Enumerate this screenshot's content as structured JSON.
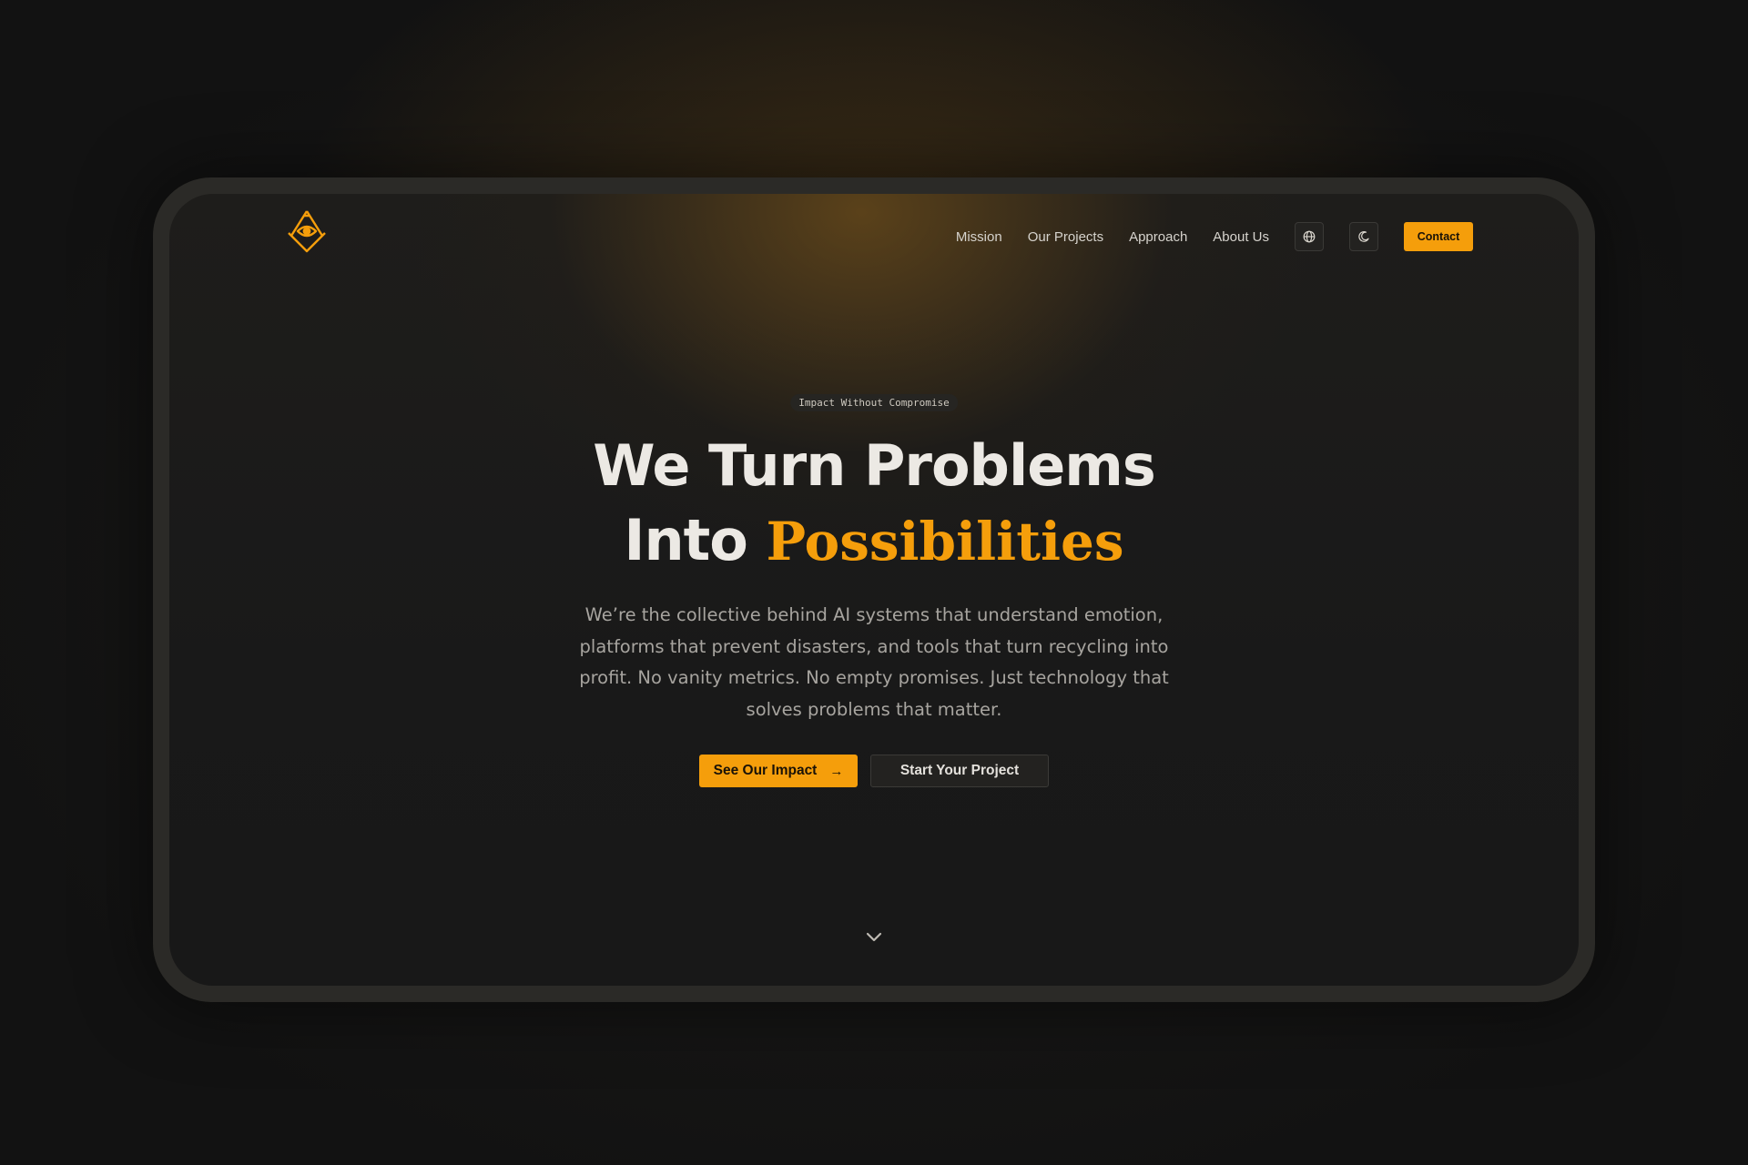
{
  "nav": {
    "links": [
      "Mission",
      "Our Projects",
      "Approach",
      "About Us"
    ],
    "language_icon": "globe-icon",
    "theme_icon": "moon-icon",
    "contact_label": "Contact"
  },
  "logo": {
    "icon": "compass-square-eye-logo"
  },
  "hero": {
    "badge": "Impact Without Compromise",
    "title_line1": "We Turn Problems",
    "title_line2_prefix": "Into ",
    "title_line2_accent": "Possibilities",
    "description": "We’re the collective behind AI systems that understand emotion, platforms that prevent disasters, and tools that turn recycling into profit. No vanity metrics. No empty promises. Just technology that solves problems that matter.",
    "primary_cta": "See Our Impact",
    "primary_cta_icon": "arrow-right-icon",
    "secondary_cta": "Start Your Project",
    "scroll_icon": "chevron-down-icon"
  },
  "colors": {
    "accent": "#f59e0b",
    "background": "#121212",
    "text": "#ece9e4",
    "muted_text": "#a7a49f"
  }
}
